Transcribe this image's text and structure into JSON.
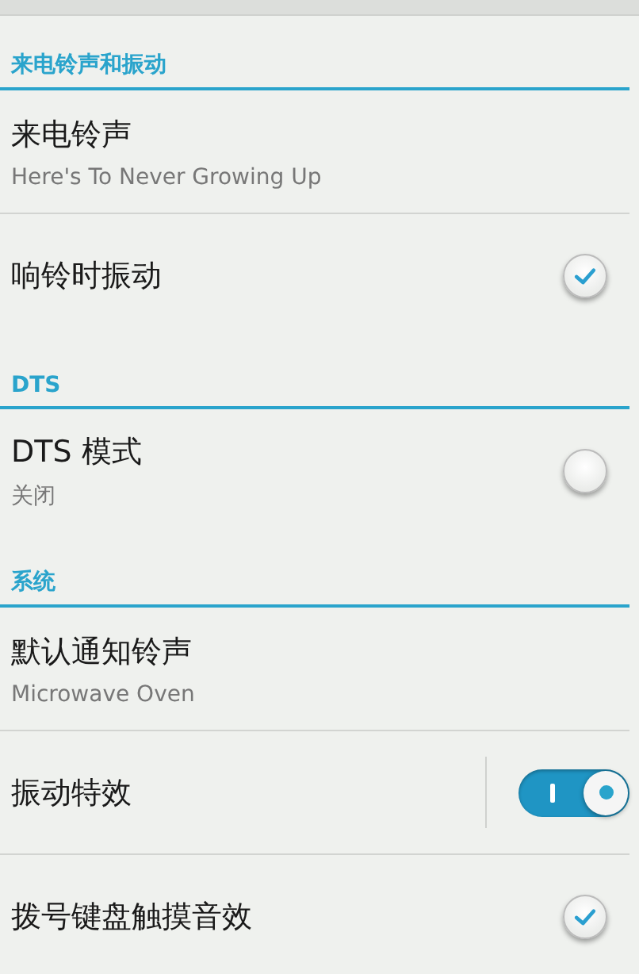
{
  "sections": [
    {
      "title": "来电铃声和振动",
      "items": [
        {
          "kind": "plain",
          "title": "来电铃声",
          "summary": "Here's To Never Growing Up"
        },
        {
          "kind": "checkbox",
          "title": "响铃时振动",
          "checked": true
        }
      ]
    },
    {
      "title": "DTS",
      "items": [
        {
          "kind": "checkbox",
          "title": "DTS 模式",
          "summary": "关闭",
          "checked": false
        }
      ]
    },
    {
      "title": "系统",
      "items": [
        {
          "kind": "plain",
          "title": "默认通知铃声",
          "summary": "Microwave Oven"
        },
        {
          "kind": "switch",
          "title": "振动特效",
          "on": true
        },
        {
          "kind": "checkbox",
          "title": "拨号键盘触摸音效",
          "checked": true
        }
      ]
    }
  ]
}
